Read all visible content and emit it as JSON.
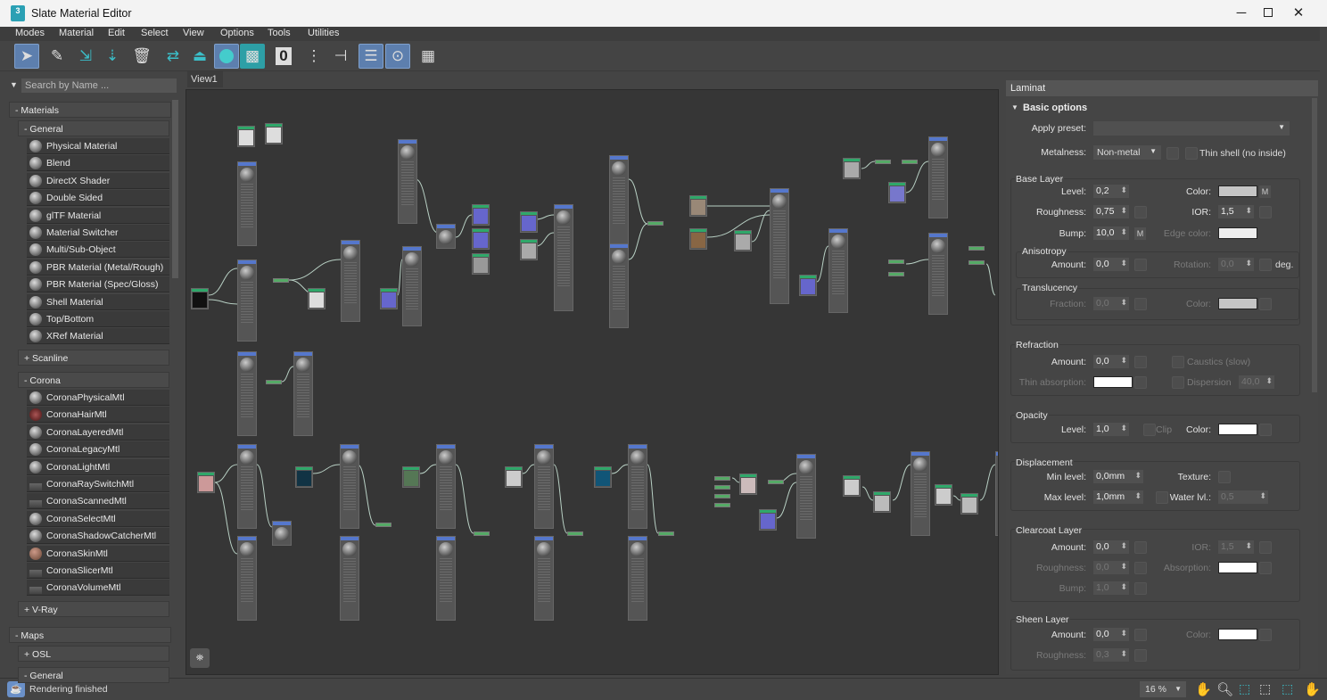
{
  "window": {
    "title": "Slate Material Editor",
    "icon_text": "3"
  },
  "menu": [
    "Modes",
    "Material",
    "Edit",
    "Select",
    "View",
    "Options",
    "Tools",
    "Utilities"
  ],
  "toolbar": {
    "zero_label": "0"
  },
  "browser": {
    "search_placeholder": "Search by Name ...",
    "materials_label": "- Materials",
    "general_label": "- General",
    "general_items": [
      "Physical Material",
      "Blend",
      "DirectX Shader",
      "Double Sided",
      "glTF Material",
      "Material Switcher",
      "Multi/Sub-Object",
      "PBR Material (Metal/Rough)",
      "PBR Material (Spec/Gloss)",
      "Shell Material",
      "Top/Bottom",
      "XRef Material"
    ],
    "scanline_label": "+ Scanline",
    "corona_label": "- Corona",
    "corona_items": [
      "CoronaPhysicalMtl",
      "CoronaHairMtl",
      "CoronaLayeredMtl",
      "CoronaLegacyMtl",
      "CoronaLightMtl",
      "CoronaRaySwitchMtl",
      "CoronaScannedMtl",
      "CoronaSelectMtl",
      "CoronaShadowCatcherMtl",
      "CoronaSkinMtl",
      "CoronaSlicerMtl",
      "CoronaVolumeMtl"
    ],
    "vray_label": "+ V-Ray",
    "maps_label": "- Maps",
    "osl_label": "+ OSL",
    "maps_general_label": "- General"
  },
  "view": {
    "tab": "View1"
  },
  "params": {
    "material_name": "Laminat",
    "rollout": "Basic options",
    "apply_preset_label": "Apply preset:",
    "apply_preset_value": "",
    "metalness_label": "Metalness:",
    "metalness_value": "Non-metal",
    "thin_shell_label": "Thin shell (no inside)",
    "base": {
      "title": "Base Layer",
      "level_label": "Level:",
      "level": "0,2",
      "color_label": "Color:",
      "m": "M",
      "roughness_label": "Roughness:",
      "roughness": "0,75",
      "ior_label": "IOR:",
      "ior": "1,5",
      "bump_label": "Bump:",
      "bump": "10,0",
      "edge_color_label": "Edge color:"
    },
    "aniso": {
      "title": "Anisotropy",
      "amount_label": "Amount:",
      "amount": "0,0",
      "rotation_label": "Rotation:",
      "rotation": "0,0",
      "deg": "deg."
    },
    "transl": {
      "title": "Translucency",
      "fraction_label": "Fraction:",
      "fraction": "0,0",
      "color_label": "Color:"
    },
    "refr": {
      "title": "Refraction",
      "amount_label": "Amount:",
      "amount": "0,0",
      "caustics_label": "Caustics (slow)",
      "thin_abs_label": "Thin absorption:",
      "dispersion_label": "Dispersion",
      "dispersion": "40,0"
    },
    "opacity": {
      "title": "Opacity",
      "level_label": "Level:",
      "level": "1,0",
      "clip_label": "Clip",
      "color_label": "Color:"
    },
    "disp": {
      "title": "Displacement",
      "min_label": "Min level:",
      "min": "0,0mm",
      "texture_label": "Texture:",
      "max_label": "Max level:",
      "max": "1,0mm",
      "water_label": "Water lvl.:",
      "water": "0,5"
    },
    "clear": {
      "title": "Clearcoat Layer",
      "amount_label": "Amount:",
      "amount": "0,0",
      "ior_label": "IOR:",
      "ior": "1,5",
      "roughness_label": "Roughness:",
      "roughness": "0,0",
      "absorption_label": "Absorption:",
      "bump_label": "Bump:",
      "bump": "1,0"
    },
    "sheen": {
      "title": "Sheen Layer",
      "amount_label": "Amount:",
      "amount": "0,0",
      "color_label": "Color:",
      "roughness_label": "Roughness:",
      "roughness": "0,3"
    }
  },
  "status": {
    "text": "Rendering finished",
    "zoom": "16 %"
  }
}
